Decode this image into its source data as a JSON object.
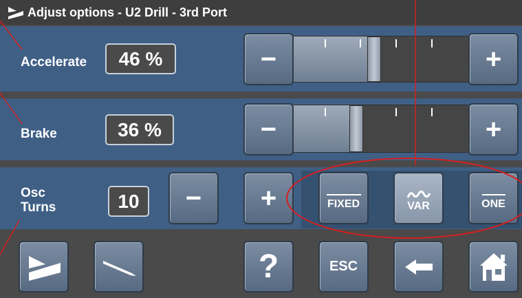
{
  "window": {
    "title": "Adjust options - U2 Drill - 3rd Port"
  },
  "accelerate": {
    "label": "Accelerate",
    "value_text": "46 %",
    "value": 46
  },
  "brake": {
    "label": "Brake",
    "value_text": "36 %",
    "value": 36
  },
  "osc": {
    "label_line1": "Osc",
    "label_line2": "Turns",
    "value_text": "10"
  },
  "buttons": {
    "minus": "−",
    "plus": "+"
  },
  "modes": {
    "fixed": "FIXED",
    "var": "VAR",
    "one": "ONE",
    "selected": "VAR"
  },
  "nav": {
    "help": "?",
    "esc": "ESC"
  },
  "icons": {
    "title": "pedal-icon",
    "pedal": "pedal-icon",
    "handpiece": "handpiece-icon",
    "back": "arrow-left-icon",
    "home": "home-icon",
    "var": "wave-icon"
  },
  "colors": {
    "panel": "#3f5f85",
    "background": "#4a4a4a",
    "button": "#6e7f96",
    "annotation": "#d42020"
  }
}
